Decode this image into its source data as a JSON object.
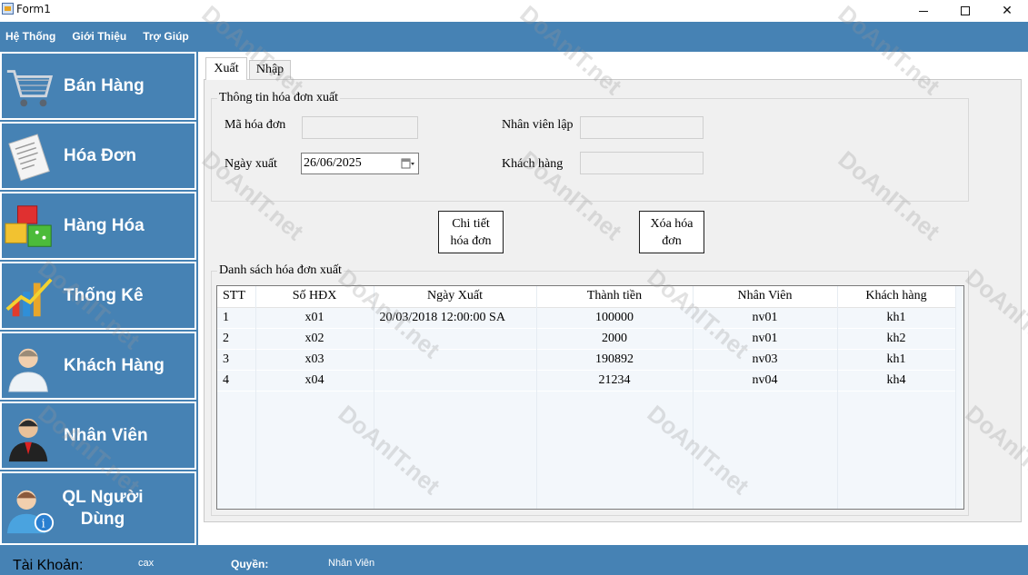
{
  "window": {
    "title": "Form1"
  },
  "menu": {
    "items": [
      "Hệ Thống",
      "Giới Thiệu",
      "Trợ Giúp"
    ]
  },
  "sidebar": {
    "items": [
      {
        "label": "Bán Hàng",
        "icon": "shopping-cart-icon"
      },
      {
        "label": "Hóa Đơn",
        "icon": "invoice-icon"
      },
      {
        "label": "Hàng Hóa",
        "icon": "goods-boxes-icon"
      },
      {
        "label": "Thống Kê",
        "icon": "statistics-chart-icon"
      },
      {
        "label": "Khách Hàng",
        "icon": "customer-icon"
      },
      {
        "label": "Nhân Viên",
        "icon": "employee-icon"
      },
      {
        "label": "QL Người Dùng",
        "label_line1": "QL Người",
        "label_line2": "Dùng",
        "icon": "user-management-icon"
      }
    ]
  },
  "tabs": [
    {
      "label": "Xuất",
      "active": true
    },
    {
      "label": "Nhập",
      "active": false
    }
  ],
  "info_group": {
    "title": "Thông tin hóa đơn xuất",
    "invoice_id_label": "Mã hóa đơn",
    "invoice_id_value": "",
    "date_label": "Ngày xuất",
    "date_value": "26/06/2025",
    "employee_label": "Nhân viên lập",
    "employee_value": "",
    "customer_label": "Khách hàng",
    "customer_value": ""
  },
  "buttons": {
    "detail_line1": "Chi tiết",
    "detail_line2": "hóa đơn",
    "delete_line1": "Xóa hóa",
    "delete_line2": "đơn"
  },
  "list_group": {
    "title": "Danh sách hóa đơn xuất",
    "columns": [
      "STT",
      "Số HĐX",
      "Ngày Xuất",
      "Thành tiền",
      "Nhân Viên",
      "Khách hàng"
    ],
    "rows": [
      [
        "1",
        "x01",
        "20/03/2018 12:00:00 SA",
        "100000",
        "nv01",
        "kh1"
      ],
      [
        "2",
        "x02",
        "",
        "2000",
        "nv01",
        "kh2"
      ],
      [
        "3",
        "x03",
        "",
        "190892",
        "nv03",
        "kh1"
      ],
      [
        "4",
        "x04",
        "",
        "21234",
        "nv04",
        "kh4"
      ]
    ]
  },
  "status": {
    "account_label": "Tài Khoản:",
    "account_value": "cax",
    "role_label": "Quyền:",
    "role_value": "Nhân Viên"
  },
  "watermark": {
    "text": "DoAnIT.net"
  },
  "colors": {
    "frame_blue": "#4682b4",
    "panel_gray": "#f0f0f0",
    "grid_row": "#f3f7fb"
  }
}
